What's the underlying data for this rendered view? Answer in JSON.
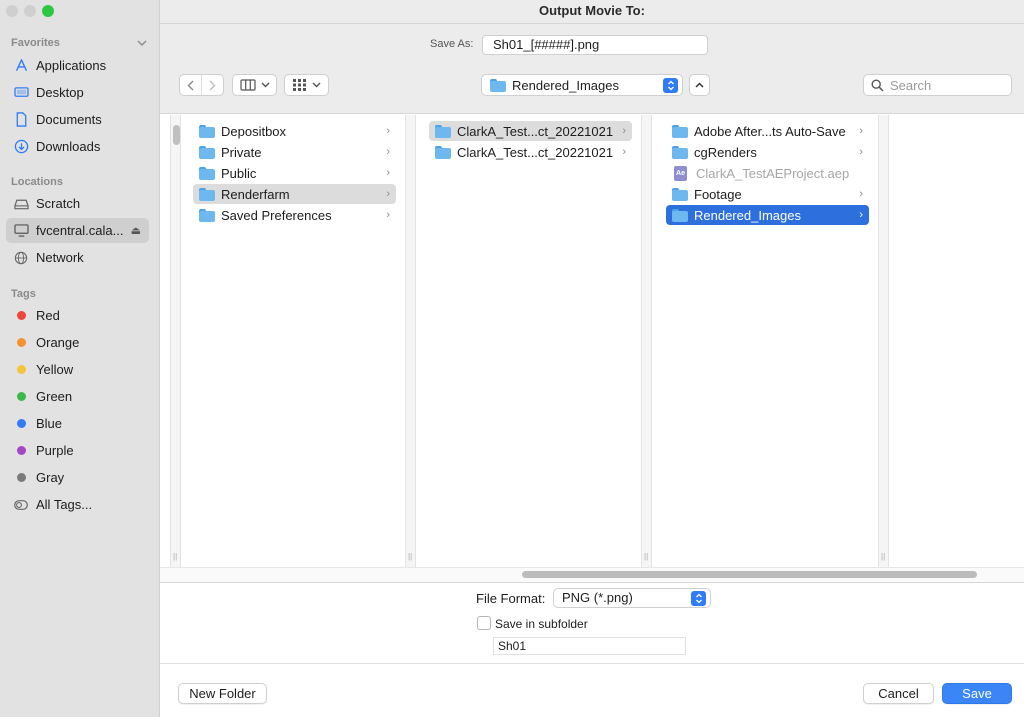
{
  "window": {
    "title": "Output Movie To:"
  },
  "sidebar": {
    "favorites_header": "Favorites",
    "favorites": [
      {
        "label": "Applications",
        "icon": "applications-icon"
      },
      {
        "label": "Desktop",
        "icon": "desktop-icon"
      },
      {
        "label": "Documents",
        "icon": "document-icon"
      },
      {
        "label": "Downloads",
        "icon": "downloads-icon"
      }
    ],
    "locations_header": "Locations",
    "locations": [
      {
        "label": "Scratch",
        "icon": "drive-icon"
      },
      {
        "label": "fvcentral.cala...",
        "icon": "display-icon",
        "selected": true
      },
      {
        "label": "Network",
        "icon": "globe-icon"
      }
    ],
    "tags_header": "Tags",
    "tags": [
      {
        "label": "Red",
        "color": "#f0433a"
      },
      {
        "label": "Orange",
        "color": "#f5912f"
      },
      {
        "label": "Yellow",
        "color": "#f5c43b"
      },
      {
        "label": "Green",
        "color": "#3cb84a"
      },
      {
        "label": "Blue",
        "color": "#2f7cf6"
      },
      {
        "label": "Purple",
        "color": "#a447c7"
      },
      {
        "label": "Gray",
        "color": "#7a7a7a"
      },
      {
        "label": "All Tags...",
        "color": ""
      }
    ]
  },
  "save_as": {
    "label": "Save As:",
    "value": "Sh01_[#####].png"
  },
  "toolbar": {
    "path_current": "Rendered_Images",
    "search_placeholder": "Search"
  },
  "columns": [
    {
      "items": [
        {
          "label": "Depositbox",
          "has_children": true
        },
        {
          "label": "Private",
          "has_children": true
        },
        {
          "label": "Public",
          "has_children": true
        },
        {
          "label": "Renderfarm",
          "has_children": true,
          "state": "selected-inactive"
        },
        {
          "label": "Saved Preferences",
          "has_children": true
        }
      ]
    },
    {
      "items": [
        {
          "label": "ClarkA_Test...ct_20221021",
          "has_children": true,
          "state": "selected-inactive"
        },
        {
          "label": "ClarkA_Test...ct_20221021",
          "has_children": true
        }
      ]
    },
    {
      "items": [
        {
          "label": "Adobe After...ts Auto-Save",
          "has_children": true
        },
        {
          "label": "cgRenders",
          "has_children": true
        },
        {
          "label": "ClarkA_TestAEProject.aep",
          "has_children": false,
          "state": "disabled",
          "file_badge": "Ae"
        },
        {
          "label": "Footage",
          "has_children": true
        },
        {
          "label": "Rendered_Images",
          "has_children": true,
          "state": "selected-active"
        }
      ]
    }
  ],
  "options": {
    "file_format_label": "File Format:",
    "file_format_value": "PNG (*.png)",
    "subfolder_checkbox_label": "Save in subfolder",
    "subfolder_checked": false,
    "subfolder_name": "Sh01"
  },
  "footer": {
    "new_folder_label": "New Folder",
    "cancel_label": "Cancel",
    "save_label": "Save"
  }
}
